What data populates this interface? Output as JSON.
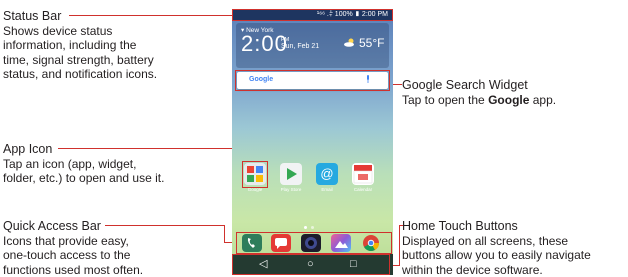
{
  "callouts": {
    "status_bar": {
      "title": "Status Bar",
      "desc": [
        "Shows device status",
        "information, including the",
        "time, signal strength, battery",
        "status, and notification icons."
      ]
    },
    "google_search": {
      "title": "Google Search Widget",
      "desc_pre": "Tap to open the ",
      "desc_bold": "Google",
      "desc_post": " app."
    },
    "app_icon": {
      "title": "App Icon",
      "desc": [
        "Tap an icon (app, widget,",
        "folder, etc.) to open and use it."
      ]
    },
    "quick_access": {
      "title": "Quick Access Bar",
      "desc": [
        "Icons that provide easy,",
        "one-touch access to the",
        "functions used most often."
      ]
    },
    "home_touch": {
      "title": "Home Touch Buttons",
      "desc": [
        "Displayed on all screens, these",
        "buttons allow you to easily navigate",
        "within the device software."
      ]
    }
  },
  "phone": {
    "status_text": "¹⁶⁶ .⫩ 100% ▮ 2:00 PM",
    "weather": {
      "city": "▾ New York",
      "time": "2:00",
      "pm": "PM",
      "date": "Sun, Feb 21",
      "temp": "55°F"
    },
    "search_logo": "Google",
    "apps": [
      {
        "name": "Google",
        "color": "#e8eaed"
      },
      {
        "name": "Play Store",
        "color": "#f1f3f4"
      },
      {
        "name": "Email",
        "color": "#26a9e0"
      },
      {
        "name": "Calendar",
        "color": "#ffffff"
      }
    ],
    "quick": [
      {
        "name": "phone-icon",
        "color": "#2e7d5b"
      },
      {
        "name": "messaging-icon",
        "color": "#e53935"
      },
      {
        "name": "camera-icon",
        "color": "#1c1c2b"
      },
      {
        "name": "gallery-icon",
        "color": "#8e5ad6"
      },
      {
        "name": "chrome-icon",
        "color": "#f4b400"
      }
    ],
    "nav": {
      "back": "◁",
      "home": "○",
      "recent": "□"
    }
  },
  "colors": {
    "callout_line": "#d0312d",
    "text": "#231f20"
  }
}
